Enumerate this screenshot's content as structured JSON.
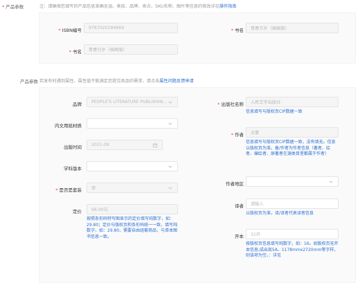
{
  "top": {
    "section_label": "产品参数",
    "note_prefix": "注：请确保您填写的产品信息准确无误。类目、品牌、卖点、SKU名称、图片等信息的修改详见",
    "note_link": "操作指南"
  },
  "panel1": {
    "isbn_label": "ISBN编号",
    "isbn_value": "9787020184669",
    "title_label": "书名",
    "title_value": "青春万岁（插图版）",
    "name_label": "书名",
    "name_value": "青春万岁（插图版）"
  },
  "params": {
    "section_label": "产品参数",
    "note_prefix": "若发布时遇到属性、属性值不能满足您提交商品的需求，请点击",
    "note_link": "属性问题反馈申请"
  },
  "left": {
    "brand_label": "品牌",
    "brand_value": "PEOPLE'S LITERATURE PUBLISHIN...",
    "paper_label": "内文用纸材质",
    "paper_value": "",
    "date_label": "出版时间",
    "date_value": "2021-09",
    "edition_label": "学科版本",
    "edition_value": "",
    "set_label": "是否是套装",
    "set_value": "否",
    "price_label": "定价",
    "price_value": "68.00元",
    "price_help": "按照条形码特写图显示的定价填写纯数字，如：29.80；定价与版权页和条形码统一一致，填写纯数字，如：29.80，需要自由组套商品，与单本图书信息一致。"
  },
  "right": {
    "publisher_label": "出版社名称",
    "publisher_value": "人民文学出版社",
    "publisher_help": "信息填写与版权页CIP数据一致",
    "author_label": "作者",
    "author_value": "王蒙",
    "author_help": "信息填写与版权页CIP数据一致，没有填无。信息以版权页为准，备/作者为作者信息（著者、绘者、编绘者、原著者在源类目里都属于作者）",
    "region_label": "作者地区",
    "region_value": "",
    "translator_label": "译者",
    "translator_value": "请输入",
    "translator_help": "以版权页为准，译/译者代表译者信息",
    "format_label": "开本",
    "format_value": "32开",
    "format_help": "按版权页信息填写纯数字，如：16。如版权页无开本信息,成出现5A、1178mmx2720mm等字样，则该项为空。：详见"
  }
}
